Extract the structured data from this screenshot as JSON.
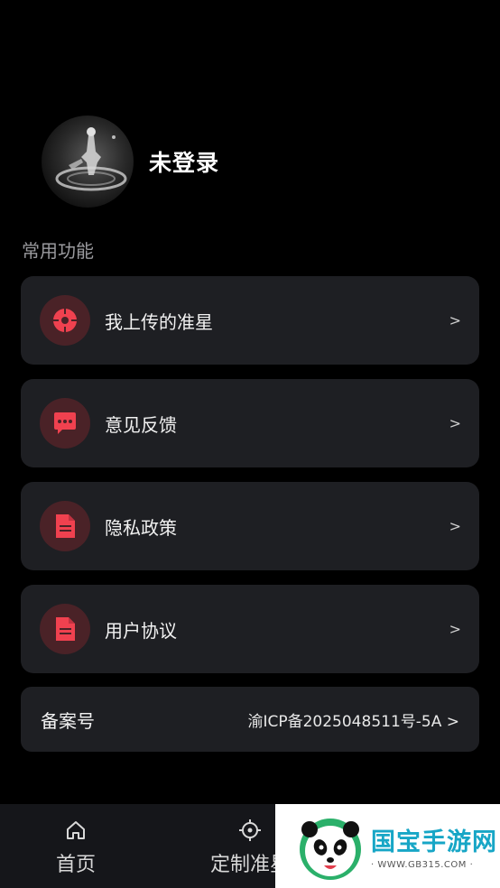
{
  "profile": {
    "username": "未登录"
  },
  "section": {
    "title": "常用功能"
  },
  "menu": [
    {
      "label": "我上传的准星",
      "icon": "crosshair-icon",
      "chevron": ">"
    },
    {
      "label": "意见反馈",
      "icon": "chat-bubble-icon",
      "chevron": ">"
    },
    {
      "label": "隐私政策",
      "icon": "document-icon",
      "chevron": ">"
    },
    {
      "label": "用户协议",
      "icon": "document-icon",
      "chevron": ">"
    }
  ],
  "record": {
    "label": "备案号",
    "value": "渝ICP备2025048511号-5A >"
  },
  "tabbar": [
    {
      "label": "首页",
      "icon": "home-icon"
    },
    {
      "label": "定制准星",
      "icon": "crosshair-icon"
    }
  ],
  "watermark": {
    "title": "国宝手游网",
    "url": "· WWW.GB315.COM ·"
  },
  "colors": {
    "accent": "#f0414f",
    "card_bg": "#1e1f23",
    "icon_bg": "#4a2227",
    "page_bg": "#000000"
  }
}
